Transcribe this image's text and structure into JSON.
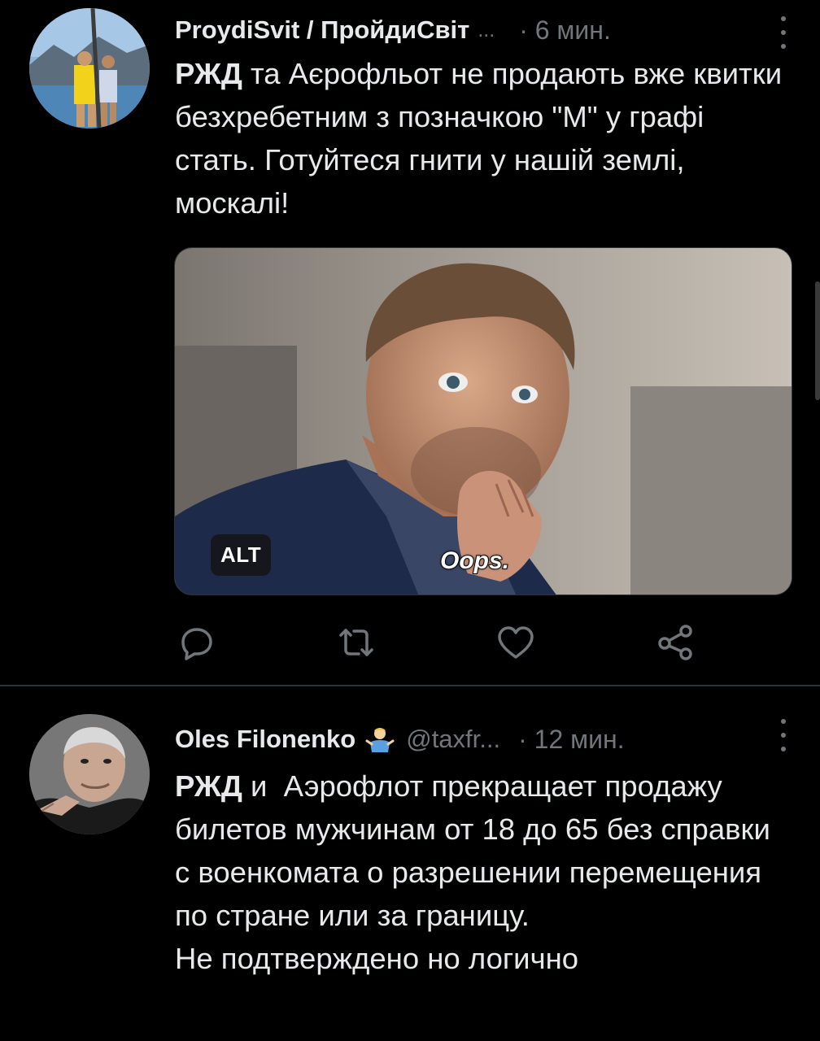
{
  "tweets": [
    {
      "author_name": "ProydiSvit / ПройдиСвіт",
      "truncation": "...",
      "time": "· 6 мин.",
      "bold_lead": "РЖД",
      "text_rest": " та Аєрофльот не продають вже квитки безхребетним з позначкою \"М\" у графі стать. Готуйтеся гнити у нашій землі, москалі!",
      "media": {
        "alt_label": "ALT",
        "caption": "Oops."
      },
      "actions": [
        "reply-icon",
        "retweet-icon",
        "like-icon",
        "share-icon"
      ]
    },
    {
      "author_name": "Oles Filonenko",
      "badge_emoji": "man-shrugging",
      "handle": "@taxfr...",
      "time": "· 12 мин.",
      "bold_lead": "РЖД",
      "text_rest": " и  Аэрофлот прекращает продажу билетов мужчинам от 18 до 65 без справки с военкомата о разрешении перемещения по стране или за границу.\nНе подтверждено но логично"
    }
  ],
  "colors": {
    "background": "#000000",
    "text": "#e7e9ea",
    "muted": "#71767b",
    "divider": "#2f3336"
  }
}
